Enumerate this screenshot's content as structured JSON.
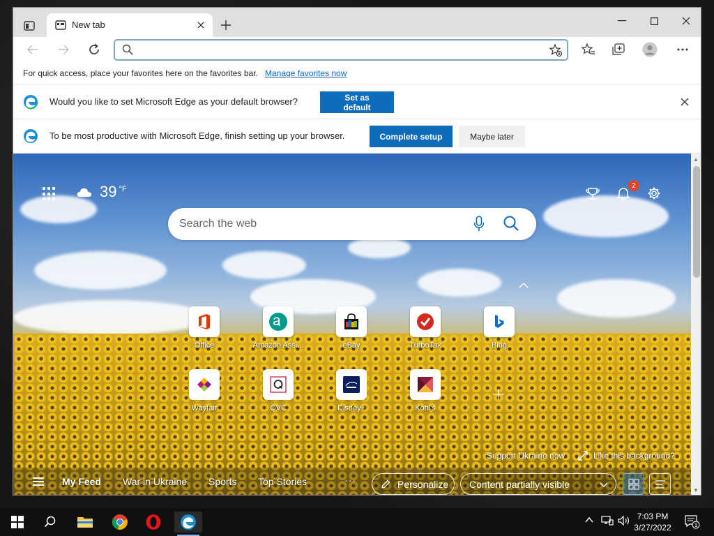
{
  "browser": {
    "tab_title": "New tab",
    "address_placeholder": "",
    "favorites_bar_text": "For quick access, place your favorites here on the favorites bar.",
    "favorites_bar_link": "Manage favorites now"
  },
  "infobars": {
    "default_prompt": "Would you like to set Microsoft Edge as your default browser?",
    "default_button": "Set as default",
    "setup_prompt": "To be most productive with Microsoft Edge, finish setting up your browser.",
    "setup_button": "Complete setup",
    "later_button": "Maybe later"
  },
  "ntp": {
    "weather_temp": "39",
    "weather_unit": "°F",
    "notification_count": "2",
    "search_placeholder": "Search the web",
    "tiles": [
      {
        "label": "Office",
        "color": "#d83b01"
      },
      {
        "label": "Amazon Assi...",
        "color": "#009b8a"
      },
      {
        "label": "eBay",
        "color": "#111111"
      },
      {
        "label": "TurboTax",
        "color": "#d52b1e"
      },
      {
        "label": "Bing",
        "color": "#0c6cd4"
      },
      {
        "label": "Wayfair",
        "color": "#7f187f"
      },
      {
        "label": "QVC",
        "color": "#c41230"
      },
      {
        "label": "Disney+",
        "color": "#0b1f5c"
      },
      {
        "label": "Kohl's",
        "color": "#8b1d3b"
      }
    ],
    "support_link": "Support Ukraine now",
    "background_link": "Like this background?",
    "feed_tabs": [
      "My Feed",
      "War in Ukraine",
      "Sports",
      "Top Stories"
    ],
    "feed_more": "···",
    "personalize": "Personalize",
    "content_visibility": "Content partially visible"
  },
  "taskbar": {
    "time": "7:03 PM",
    "date": "3/27/2022",
    "notification_count": "1"
  },
  "colors": {
    "accent": "#0f6cbd",
    "link": "#0b63c4"
  }
}
